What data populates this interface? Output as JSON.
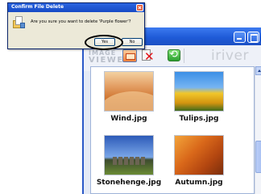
{
  "dialog": {
    "title": "Confirm File Delete",
    "message": "Are you sure you want to delete 'Purple flower'?",
    "yes_label": "Yes",
    "no_label": "No"
  },
  "viewer": {
    "brand_line1": "IMAGE",
    "brand_line2": "VIEWER",
    "logo": "iriver",
    "thumbnails": [
      {
        "caption": "Wind.jpg"
      },
      {
        "caption": "Tulips.jpg"
      },
      {
        "caption": "Stonehenge.jpg"
      },
      {
        "caption": "Autumn.jpg"
      }
    ]
  },
  "colors": {
    "titlebar_blue": "#1f5bd8",
    "highlight_ring": "#000000"
  }
}
